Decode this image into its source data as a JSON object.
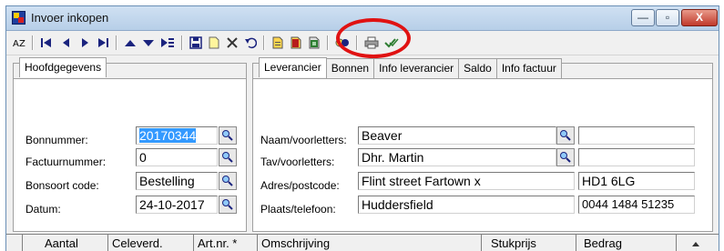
{
  "window": {
    "title": "Invoer inkopen",
    "controls": {
      "minimize": "—",
      "maximize": "▫",
      "close": "X"
    }
  },
  "toolbar": {
    "buttons": [
      "sort-icon",
      "first-record-icon",
      "previous-record-icon",
      "next-record-icon",
      "last-record-icon",
      "move-up-icon",
      "move-down-icon",
      "filter-icon",
      "save-icon",
      "new-document-icon",
      "delete-icon",
      "undo-icon",
      "document-yellow-icon",
      "document-red-icon",
      "document-green-icon",
      "calculate-icon",
      "print-icon",
      "check-icon"
    ]
  },
  "left_panel": {
    "tab": "Hoofdgegevens",
    "fields": {
      "bonnummer": {
        "label": "Bonnummer:",
        "value": "20170344"
      },
      "factuurnummer": {
        "label": "Factuurnummer:",
        "value": "0"
      },
      "bonsoort": {
        "label": "Bonsoort code:",
        "value": "Bestelling"
      },
      "datum": {
        "label": "Datum:",
        "value": "24-10-2017"
      }
    }
  },
  "right_panel": {
    "tabs": [
      "Leverancier",
      "Bonnen",
      "Info leverancier",
      "Saldo",
      "Info factuur"
    ],
    "active_tab": "Leverancier",
    "fields": {
      "naam": {
        "label": "Naam/voorletters:",
        "value": "Beaver",
        "extra": ""
      },
      "tav": {
        "label": "Tav/voorletters:",
        "value": "Dhr. Martin",
        "extra": ""
      },
      "adres": {
        "label": "Adres/postcode:",
        "value": "Flint street Fartown x",
        "extra": "HD1 6LG"
      },
      "plaats": {
        "label": "Plaats/telefoon:",
        "value": "Huddersfield",
        "extra": "0044 1484 51235"
      }
    }
  },
  "grid": {
    "columns": [
      "Aantal",
      "Celeverd.",
      "Art.nr. *",
      "Omschrijving",
      "Stukprijs",
      "Bedrag"
    ]
  },
  "colors": {
    "highlight": "#e01212",
    "selection": "#3399ff"
  }
}
